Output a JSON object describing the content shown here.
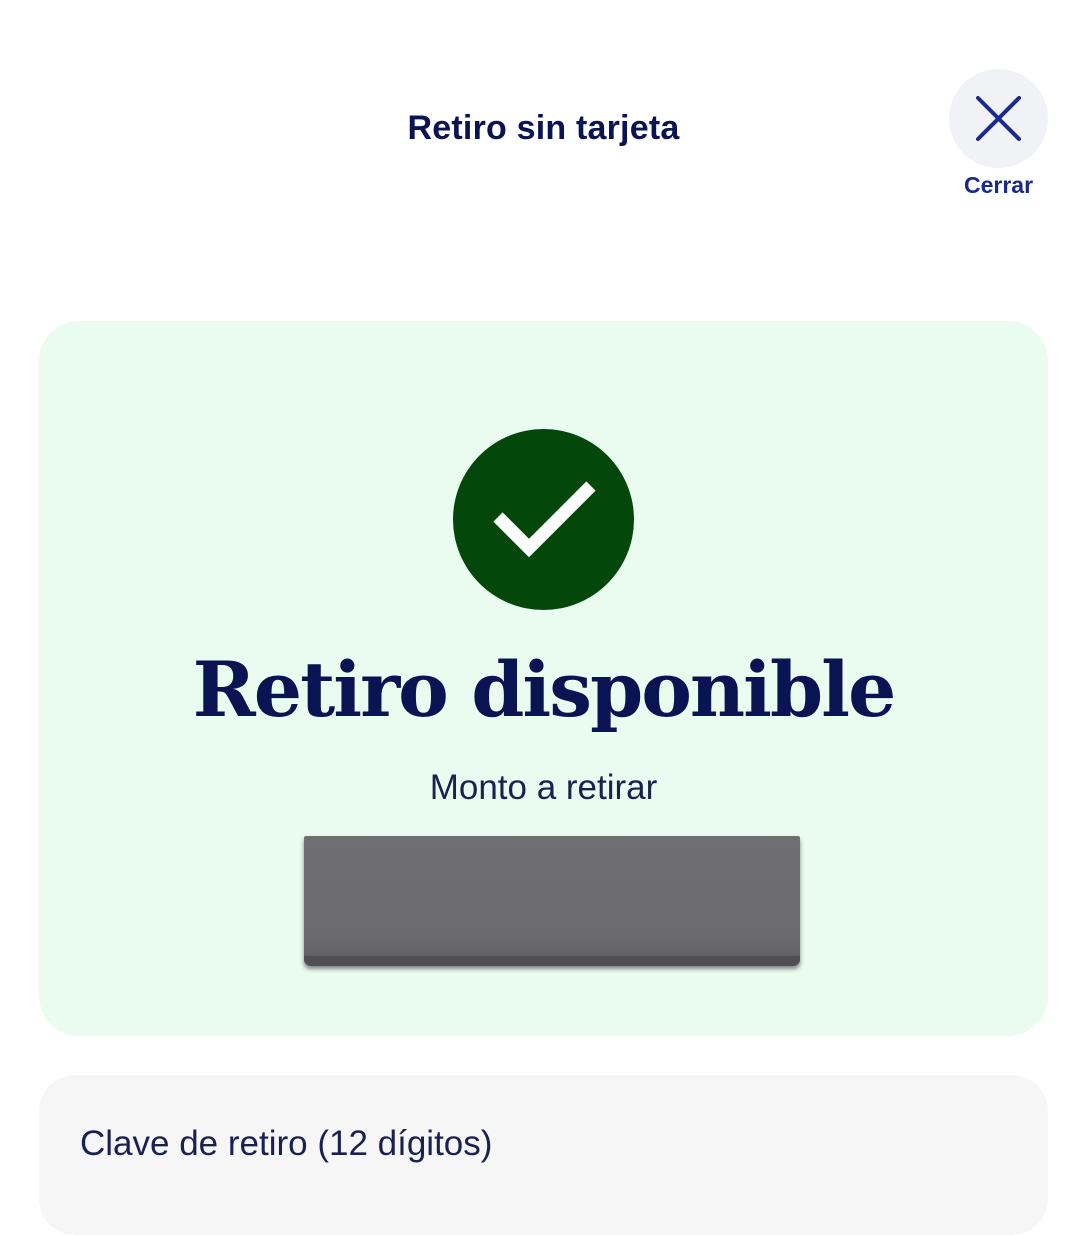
{
  "header": {
    "title": "Retiro sin tarjeta",
    "close_label": "Cerrar",
    "close_icon": "close-icon"
  },
  "status": {
    "icon": "checkmark-icon",
    "icon_color": "#03480a",
    "card_color": "#eafcef",
    "title": "Retiro disponible",
    "amount_label": "Monto a retirar"
  },
  "withdrawal_key": {
    "label": "Clave de retiro (12 dígitos)"
  },
  "colors": {
    "primary_text": "#0b1452",
    "accent": "#1a2a8a"
  }
}
